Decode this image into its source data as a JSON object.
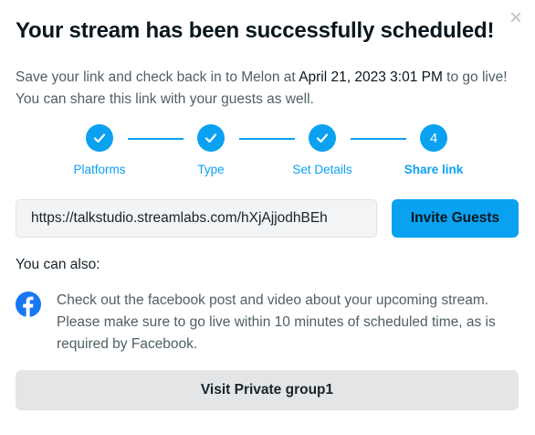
{
  "dialog": {
    "title": "Your stream has been successfully scheduled!",
    "description_prefix": "Save your link and check back in to Melon at ",
    "description_date": "April 21, 2023 3:01 PM",
    "description_suffix": " to go live! You can share this link with your guests as well."
  },
  "steps": [
    {
      "label": "Platforms",
      "state": "done"
    },
    {
      "label": "Type",
      "state": "done"
    },
    {
      "label": "Set Details",
      "state": "done"
    },
    {
      "label": "Share link",
      "number": "4",
      "state": "active"
    }
  ],
  "share": {
    "link": "https://talkstudio.streamlabs.com/hXjAjjodhBEh",
    "invite_label": "Invite Guests"
  },
  "also_label": "You can also:",
  "facebook": {
    "text": "Check out the facebook post and video about your upcoming stream. Please make sure to go live within 10 minutes of scheduled time, as is required by Facebook.",
    "icon": "facebook-icon",
    "brand_color": "#1877f2"
  },
  "group_button_label": "Visit Private group1",
  "colors": {
    "accent": "#0ba1f1",
    "text": "#09161d",
    "muted": "#4f5e65"
  }
}
